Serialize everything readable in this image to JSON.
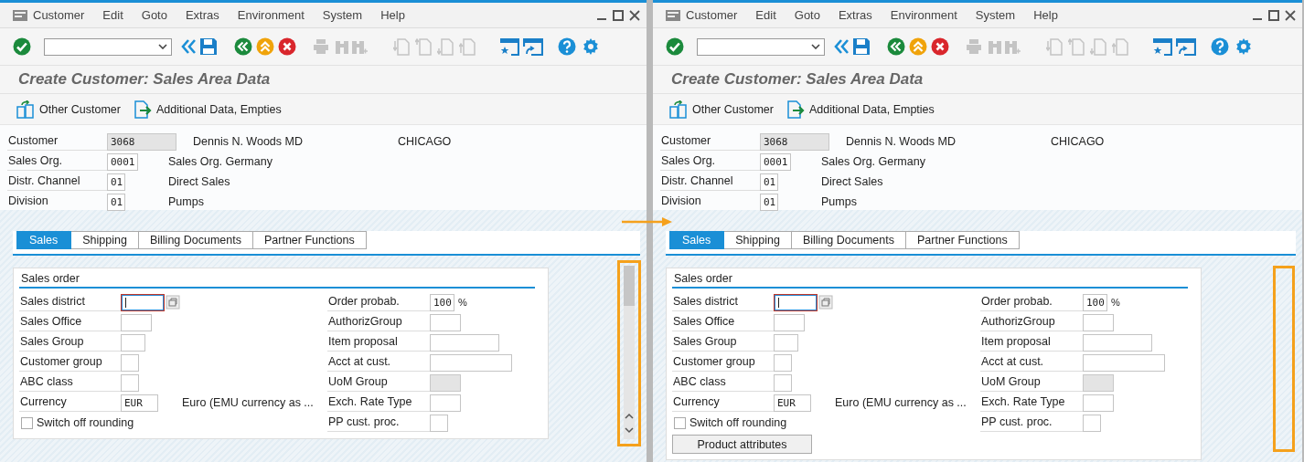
{
  "windows": [
    {
      "menu": [
        "Customer",
        "Edit",
        "Goto",
        "Extras",
        "Environment",
        "System",
        "Help"
      ],
      "title": "Create Customer: Sales Area Data",
      "app_toolbar": [
        {
          "label": "Other Customer",
          "kind": "switch"
        },
        {
          "label": "Additional Data, Empties",
          "kind": "additional"
        }
      ],
      "header": [
        {
          "label": "Customer",
          "value": "3068",
          "disabled": true,
          "description": "Dennis N. Woods MD",
          "extra": "CHICAGO"
        },
        {
          "label": "Sales Org.",
          "value": "0001",
          "disabled": false,
          "description": "Sales Org. Germany"
        },
        {
          "label": "Distr. Channel",
          "value": "01",
          "disabled": false,
          "description": "Direct Sales"
        },
        {
          "label": "Division",
          "value": "01",
          "disabled": false,
          "description": "Pumps"
        }
      ],
      "tabs": [
        {
          "label": "Sales",
          "selected": true
        },
        {
          "label": "Shipping",
          "selected": false
        },
        {
          "label": "Billing Documents",
          "selected": false
        },
        {
          "label": "Partner Functions",
          "selected": false
        }
      ],
      "group": {
        "title": "Sales order",
        "left": [
          {
            "kind": "field",
            "label": "Sales district",
            "focused": true,
            "disabled": false
          },
          {
            "kind": "field",
            "label": "Sales Office",
            "focused": false,
            "disabled": false
          },
          {
            "kind": "field",
            "label": "Sales Group",
            "focused": false,
            "disabled": false
          },
          {
            "kind": "field",
            "label": "Customer group",
            "focused": false,
            "disabled": false
          },
          {
            "kind": "field",
            "label": "ABC class",
            "focused": false,
            "disabled": false
          },
          {
            "kind": "field",
            "label": "Currency",
            "value": "EUR",
            "focused": false,
            "disabled": false,
            "description": "Euro (EMU currency as ..."
          },
          {
            "kind": "checkbox",
            "label": "Switch off rounding",
            "checked": false
          }
        ],
        "right": [
          {
            "kind": "field",
            "label": "Order probab.",
            "value": "100",
            "unit": "%",
            "focused": false,
            "disabled": false
          },
          {
            "kind": "field",
            "label": "AuthorizGroup",
            "focused": false,
            "disabled": false
          },
          {
            "kind": "field",
            "label": "Item proposal",
            "focused": false,
            "disabled": false
          },
          {
            "kind": "field",
            "label": "Acct at cust.",
            "focused": false,
            "disabled": false
          },
          {
            "kind": "field",
            "label": "UoM Group",
            "focused": false,
            "disabled": true
          },
          {
            "kind": "field",
            "label": "Exch. Rate Type",
            "focused": false,
            "disabled": false
          },
          {
            "kind": "field",
            "label": "PP cust. proc.",
            "focused": false,
            "disabled": false
          }
        ]
      },
      "scrollbar": true,
      "highlight": true
    },
    {
      "menu": [
        "Customer",
        "Edit",
        "Goto",
        "Extras",
        "Environment",
        "System",
        "Help"
      ],
      "title": "Create Customer: Sales Area Data",
      "app_toolbar": [
        {
          "label": "Other Customer",
          "kind": "switch"
        },
        {
          "label": "Additional Data, Empties",
          "kind": "additional"
        }
      ],
      "header": [
        {
          "label": "Customer",
          "value": "3068",
          "disabled": true,
          "description": "Dennis N. Woods MD",
          "extra": "CHICAGO"
        },
        {
          "label": "Sales Org.",
          "value": "0001",
          "disabled": false,
          "description": "Sales Org. Germany"
        },
        {
          "label": "Distr. Channel",
          "value": "01",
          "disabled": false,
          "description": "Direct Sales"
        },
        {
          "label": "Division",
          "value": "01",
          "disabled": false,
          "description": "Pumps"
        }
      ],
      "tabs": [
        {
          "label": "Sales",
          "selected": true
        },
        {
          "label": "Shipping",
          "selected": false
        },
        {
          "label": "Billing Documents",
          "selected": false
        },
        {
          "label": "Partner Functions",
          "selected": false
        }
      ],
      "group": {
        "title": "Sales order",
        "left": [
          {
            "kind": "field",
            "label": "Sales district",
            "focused": true,
            "disabled": false
          },
          {
            "kind": "field",
            "label": "Sales Office",
            "focused": false,
            "disabled": false
          },
          {
            "kind": "field",
            "label": "Sales Group",
            "focused": false,
            "disabled": false
          },
          {
            "kind": "field",
            "label": "Customer group",
            "focused": false,
            "disabled": false
          },
          {
            "kind": "field",
            "label": "ABC class",
            "focused": false,
            "disabled": false
          },
          {
            "kind": "field",
            "label": "Currency",
            "value": "EUR",
            "focused": false,
            "disabled": false,
            "description": "Euro (EMU currency as ..."
          },
          {
            "kind": "checkbox",
            "label": "Switch off rounding",
            "checked": false
          }
        ],
        "right": [
          {
            "kind": "field",
            "label": "Order probab.",
            "value": "100",
            "unit": "%",
            "focused": false,
            "disabled": false
          },
          {
            "kind": "field",
            "label": "AuthorizGroup",
            "focused": false,
            "disabled": false
          },
          {
            "kind": "field",
            "label": "Item proposal",
            "focused": false,
            "disabled": false
          },
          {
            "kind": "field",
            "label": "Acct at cust.",
            "focused": false,
            "disabled": false
          },
          {
            "kind": "field",
            "label": "UoM Group",
            "focused": false,
            "disabled": true
          },
          {
            "kind": "field",
            "label": "Exch. Rate Type",
            "focused": false,
            "disabled": false
          },
          {
            "kind": "field",
            "label": "PP cust. proc.",
            "focused": false,
            "disabled": false
          }
        ]
      },
      "buttons": [
        "Product attributes"
      ],
      "highlight": true
    }
  ]
}
